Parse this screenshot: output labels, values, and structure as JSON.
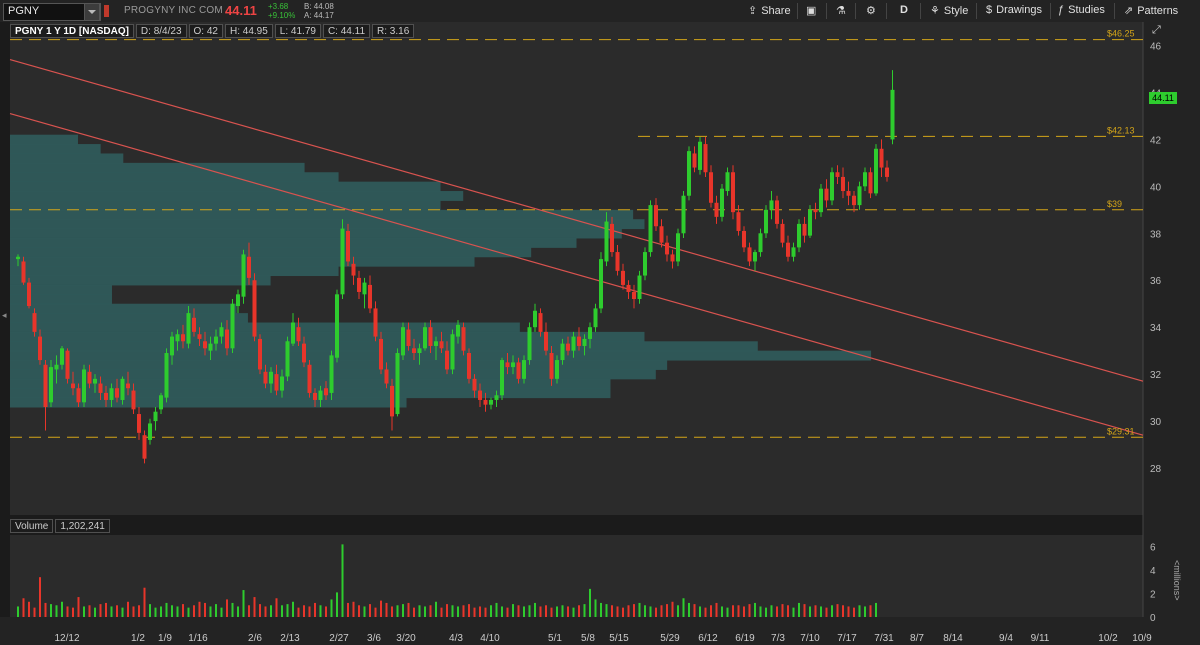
{
  "toolbar": {
    "symbol": "PGNY",
    "company": "PROGYNY INC COM",
    "last": "44.11",
    "change": "+3.68",
    "change_pct": "+9.10%",
    "bid": "B: 44.08",
    "ask": "A: 44.17",
    "share_label": "Share",
    "period_label": "D",
    "style_label": "Style",
    "drawings_label": "Drawings",
    "studies_label": "Studies",
    "patterns_label": "Patterns"
  },
  "info": {
    "symbol_desc": "PGNY 1 Y 1D [NASDAQ]",
    "date": "D: 8/4/23",
    "open": "O: 42",
    "high": "H: 44.95",
    "low": "L: 41.79",
    "close": "C: 44.11",
    "range": "R: 3.16"
  },
  "volume_info": {
    "label": "Volume",
    "value": "1,202,241"
  },
  "price_tag": "44.11",
  "volume_units": "<millions>",
  "colors": {
    "up": "#2ecc2e",
    "down": "#e8352a",
    "profile": "#2f5a5a",
    "level": "#d4a518",
    "trend": "#d9534f",
    "bg": "#2b2b2b"
  },
  "chart_data": {
    "type": "candlestick",
    "ylim": [
      26,
      47
    ],
    "y_ticks": [
      28,
      30,
      32,
      34,
      36,
      38,
      40,
      42,
      44,
      46
    ],
    "x_tick_labels": [
      "12/12",
      "1/2",
      "1/9",
      "1/16",
      "2/6",
      "2/13",
      "2/27",
      "3/6",
      "3/20",
      "4/3",
      "4/10",
      "5/1",
      "5/8",
      "5/15",
      "5/29",
      "6/12",
      "6/19",
      "7/3",
      "7/10",
      "7/17",
      "7/31",
      "8/7",
      "8/14",
      "9/4",
      "9/11",
      "10/2",
      "10/9"
    ],
    "levels": [
      {
        "label": "$46.25",
        "value": 46.25
      },
      {
        "label": "$42.13",
        "value": 42.13
      },
      {
        "label": "$39",
        "value": 39
      },
      {
        "label": "$29.31",
        "value": 29.31
      }
    ],
    "trendlines": [
      {
        "from": [
          0,
          45.4
        ],
        "to": [
          1,
          31.7
        ]
      },
      {
        "from": [
          0,
          43.1
        ],
        "to": [
          1,
          29.4
        ]
      }
    ],
    "volume_profile": [
      {
        "price": 42.0,
        "width": 0.06
      },
      {
        "price": 41.6,
        "width": 0.08
      },
      {
        "price": 41.2,
        "width": 0.1
      },
      {
        "price": 40.8,
        "width": 0.26
      },
      {
        "price": 40.4,
        "width": 0.29
      },
      {
        "price": 40.0,
        "width": 0.38
      },
      {
        "price": 39.6,
        "width": 0.4
      },
      {
        "price": 39.2,
        "width": 0.38
      },
      {
        "price": 38.8,
        "width": 0.55
      },
      {
        "price": 38.4,
        "width": 0.56
      },
      {
        "price": 38.0,
        "width": 0.54
      },
      {
        "price": 37.6,
        "width": 0.5
      },
      {
        "price": 37.2,
        "width": 0.46
      },
      {
        "price": 36.8,
        "width": 0.41
      },
      {
        "price": 36.4,
        "width": 0.29
      },
      {
        "price": 36.0,
        "width": 0.23
      },
      {
        "price": 35.6,
        "width": 0.09
      },
      {
        "price": 35.2,
        "width": 0.09
      },
      {
        "price": 34.8,
        "width": 0.2
      },
      {
        "price": 34.4,
        "width": 0.21
      },
      {
        "price": 34.0,
        "width": 0.45
      },
      {
        "price": 33.6,
        "width": 0.56
      },
      {
        "price": 33.2,
        "width": 0.66
      },
      {
        "price": 32.8,
        "width": 0.76
      },
      {
        "price": 32.4,
        "width": 0.58
      },
      {
        "price": 32.0,
        "width": 0.57
      },
      {
        "price": 31.6,
        "width": 0.53
      },
      {
        "price": 31.2,
        "width": 0.53
      },
      {
        "price": 30.8,
        "width": 0.35
      }
    ],
    "candles": [
      [
        36.9,
        37.1,
        36.6,
        37.0
      ],
      [
        36.8,
        37.0,
        35.8,
        35.9
      ],
      [
        35.9,
        36.1,
        34.8,
        34.9
      ],
      [
        34.6,
        34.8,
        33.6,
        33.8
      ],
      [
        33.6,
        33.9,
        32.4,
        32.6
      ],
      [
        32.4,
        32.6,
        29.6,
        30.6
      ],
      [
        30.8,
        32.6,
        30.6,
        32.3
      ],
      [
        32.2,
        32.8,
        31.6,
        32.4
      ],
      [
        32.4,
        33.2,
        32.2,
        33.1
      ],
      [
        33.0,
        33.1,
        31.6,
        31.8
      ],
      [
        31.6,
        32.1,
        31.1,
        31.4
      ],
      [
        31.4,
        31.6,
        30.6,
        30.8
      ],
      [
        30.8,
        32.4,
        30.6,
        32.2
      ],
      [
        32.1,
        32.4,
        31.4,
        31.6
      ],
      [
        31.6,
        32.0,
        31.2,
        31.8
      ],
      [
        31.6,
        31.9,
        30.9,
        31.2
      ],
      [
        31.2,
        31.5,
        30.6,
        30.9
      ],
      [
        30.9,
        31.6,
        30.6,
        31.4
      ],
      [
        31.4,
        31.8,
        30.8,
        31.0
      ],
      [
        30.9,
        31.9,
        30.7,
        31.8
      ],
      [
        31.6,
        32.1,
        31.1,
        31.4
      ],
      [
        31.3,
        31.6,
        30.3,
        30.5
      ],
      [
        30.3,
        30.6,
        29.2,
        29.5
      ],
      [
        29.4,
        29.6,
        28.2,
        28.4
      ],
      [
        29.2,
        30.1,
        29.0,
        29.9
      ],
      [
        30.0,
        30.6,
        29.6,
        30.4
      ],
      [
        30.5,
        31.2,
        30.3,
        31.1
      ],
      [
        31.0,
        33.1,
        30.8,
        32.9
      ],
      [
        32.8,
        33.8,
        32.4,
        33.6
      ],
      [
        33.4,
        33.9,
        33.0,
        33.7
      ],
      [
        33.7,
        34.1,
        33.1,
        33.4
      ],
      [
        33.3,
        34.9,
        33.1,
        34.6
      ],
      [
        34.4,
        34.8,
        33.6,
        33.8
      ],
      [
        33.7,
        34.0,
        33.2,
        33.5
      ],
      [
        33.4,
        33.8,
        32.8,
        33.1
      ],
      [
        33.0,
        33.6,
        32.6,
        33.3
      ],
      [
        33.3,
        33.9,
        33.0,
        33.6
      ],
      [
        33.6,
        34.2,
        33.3,
        34.0
      ],
      [
        33.9,
        34.3,
        32.8,
        33.1
      ],
      [
        33.1,
        35.2,
        32.9,
        35.0
      ],
      [
        34.9,
        35.6,
        34.6,
        35.4
      ],
      [
        35.3,
        37.3,
        35.0,
        37.1
      ],
      [
        37.0,
        37.6,
        35.8,
        36.1
      ],
      [
        36.0,
        36.3,
        33.4,
        33.6
      ],
      [
        33.5,
        33.7,
        32.0,
        32.2
      ],
      [
        32.1,
        32.4,
        31.4,
        31.6
      ],
      [
        31.6,
        32.3,
        31.2,
        32.1
      ],
      [
        32.0,
        32.4,
        31.1,
        31.3
      ],
      [
        31.3,
        32.2,
        31.0,
        31.9
      ],
      [
        31.9,
        33.6,
        31.7,
        33.4
      ],
      [
        33.3,
        34.6,
        33.2,
        34.2
      ],
      [
        34.0,
        34.4,
        33.2,
        33.4
      ],
      [
        33.3,
        33.6,
        32.3,
        32.5
      ],
      [
        32.4,
        32.6,
        31.0,
        31.2
      ],
      [
        31.2,
        31.4,
        30.6,
        30.9
      ],
      [
        30.9,
        31.5,
        30.6,
        31.3
      ],
      [
        31.4,
        31.7,
        30.9,
        31.1
      ],
      [
        31.2,
        33.0,
        30.9,
        32.8
      ],
      [
        32.7,
        35.6,
        32.5,
        35.4
      ],
      [
        35.4,
        38.6,
        35.2,
        38.2
      ],
      [
        38.1,
        38.4,
        36.6,
        36.8
      ],
      [
        36.7,
        37.0,
        35.8,
        36.2
      ],
      [
        36.1,
        36.4,
        35.2,
        35.5
      ],
      [
        35.4,
        36.1,
        34.8,
        35.9
      ],
      [
        35.8,
        36.2,
        34.6,
        34.8
      ],
      [
        34.8,
        35.1,
        33.4,
        33.6
      ],
      [
        33.5,
        33.8,
        32.0,
        32.2
      ],
      [
        32.2,
        32.5,
        31.4,
        31.6
      ],
      [
        31.5,
        31.8,
        29.6,
        30.2
      ],
      [
        30.3,
        33.1,
        30.2,
        32.9
      ],
      [
        32.8,
        34.2,
        32.6,
        34.0
      ],
      [
        33.9,
        34.2,
        33.0,
        33.2
      ],
      [
        33.1,
        33.5,
        32.6,
        32.9
      ],
      [
        32.9,
        33.3,
        32.4,
        33.1
      ],
      [
        33.1,
        34.2,
        33.0,
        34.0
      ],
      [
        34.0,
        34.3,
        32.9,
        33.2
      ],
      [
        33.2,
        33.6,
        32.6,
        33.4
      ],
      [
        33.4,
        33.8,
        32.9,
        33.1
      ],
      [
        33.0,
        33.4,
        32.0,
        32.2
      ],
      [
        32.2,
        33.9,
        32.0,
        33.7
      ],
      [
        33.6,
        34.3,
        33.3,
        34.1
      ],
      [
        34.0,
        34.2,
        32.8,
        33.0
      ],
      [
        32.9,
        33.1,
        31.6,
        31.8
      ],
      [
        31.8,
        32.0,
        31.0,
        31.3
      ],
      [
        31.3,
        31.6,
        30.6,
        30.9
      ],
      [
        30.9,
        31.2,
        30.4,
        30.7
      ],
      [
        30.7,
        31.0,
        30.5,
        30.9
      ],
      [
        30.9,
        31.3,
        30.6,
        31.1
      ],
      [
        31.1,
        32.7,
        30.9,
        32.6
      ],
      [
        32.5,
        32.9,
        32.0,
        32.3
      ],
      [
        32.3,
        32.8,
        32.0,
        32.5
      ],
      [
        32.5,
        32.7,
        31.6,
        31.8
      ],
      [
        31.8,
        32.8,
        31.6,
        32.6
      ],
      [
        32.6,
        34.2,
        32.4,
        34.0
      ],
      [
        34.0,
        35.0,
        33.8,
        34.7
      ],
      [
        34.6,
        34.8,
        33.6,
        33.8
      ],
      [
        33.8,
        34.2,
        32.8,
        33.0
      ],
      [
        32.9,
        33.2,
        31.5,
        31.8
      ],
      [
        31.8,
        32.8,
        31.6,
        32.6
      ],
      [
        32.6,
        33.5,
        32.4,
        33.3
      ],
      [
        33.3,
        33.6,
        32.8,
        33.0
      ],
      [
        33.0,
        33.8,
        32.7,
        33.6
      ],
      [
        33.6,
        34.0,
        33.0,
        33.2
      ],
      [
        33.2,
        33.7,
        32.8,
        33.5
      ],
      [
        33.5,
        34.2,
        33.1,
        34.0
      ],
      [
        34.0,
        35.0,
        33.8,
        34.8
      ],
      [
        34.8,
        37.2,
        34.6,
        36.9
      ],
      [
        36.8,
        38.9,
        36.6,
        38.5
      ],
      [
        38.4,
        38.7,
        37.0,
        37.2
      ],
      [
        37.2,
        37.5,
        36.2,
        36.4
      ],
      [
        36.4,
        36.7,
        35.6,
        35.8
      ],
      [
        35.8,
        36.0,
        35.2,
        35.5
      ],
      [
        35.5,
        35.8,
        34.8,
        35.2
      ],
      [
        35.2,
        36.4,
        35.0,
        36.2
      ],
      [
        36.2,
        37.4,
        36.0,
        37.2
      ],
      [
        37.2,
        39.4,
        37.0,
        39.2
      ],
      [
        39.2,
        39.5,
        38.1,
        38.3
      ],
      [
        38.3,
        38.6,
        37.4,
        37.6
      ],
      [
        37.6,
        37.9,
        36.8,
        37.1
      ],
      [
        37.1,
        37.3,
        36.5,
        36.8
      ],
      [
        36.8,
        38.2,
        36.6,
        38.0
      ],
      [
        38.0,
        39.8,
        37.8,
        39.6
      ],
      [
        39.6,
        41.7,
        39.4,
        41.5
      ],
      [
        41.4,
        41.7,
        40.6,
        40.8
      ],
      [
        40.7,
        42.1,
        40.5,
        41.9
      ],
      [
        41.8,
        42.1,
        40.4,
        40.6
      ],
      [
        40.6,
        40.9,
        39.1,
        39.3
      ],
      [
        39.3,
        39.6,
        38.4,
        38.7
      ],
      [
        38.7,
        40.1,
        38.5,
        39.9
      ],
      [
        39.8,
        40.8,
        39.6,
        40.6
      ],
      [
        40.6,
        40.9,
        38.6,
        38.9
      ],
      [
        38.9,
        39.2,
        37.9,
        38.1
      ],
      [
        38.1,
        38.3,
        37.2,
        37.4
      ],
      [
        37.4,
        37.6,
        36.6,
        36.8
      ],
      [
        36.8,
        37.3,
        36.4,
        37.2
      ],
      [
        37.2,
        38.2,
        37.0,
        38.0
      ],
      [
        38.0,
        39.2,
        37.8,
        39.0
      ],
      [
        39.0,
        39.8,
        38.6,
        39.4
      ],
      [
        39.4,
        39.6,
        38.2,
        38.4
      ],
      [
        38.4,
        38.6,
        37.4,
        37.6
      ],
      [
        37.6,
        37.9,
        36.8,
        37.0
      ],
      [
        37.0,
        37.6,
        36.8,
        37.4
      ],
      [
        37.4,
        38.6,
        37.2,
        38.4
      ],
      [
        38.4,
        38.7,
        37.6,
        37.9
      ],
      [
        37.9,
        39.2,
        37.8,
        39.0
      ],
      [
        39.0,
        39.3,
        38.6,
        38.9
      ],
      [
        38.9,
        40.1,
        38.7,
        39.9
      ],
      [
        39.9,
        40.3,
        39.1,
        39.4
      ],
      [
        39.4,
        40.8,
        39.2,
        40.6
      ],
      [
        40.6,
        40.9,
        40.1,
        40.4
      ],
      [
        40.4,
        40.8,
        39.5,
        39.8
      ],
      [
        39.8,
        40.2,
        39.2,
        39.6
      ],
      [
        39.6,
        39.8,
        38.9,
        39.2
      ],
      [
        39.2,
        40.2,
        39.0,
        40.0
      ],
      [
        40.0,
        40.8,
        39.8,
        40.6
      ],
      [
        40.6,
        40.8,
        39.5,
        39.7
      ],
      [
        39.7,
        41.8,
        39.6,
        41.6
      ],
      [
        41.6,
        42.0,
        40.4,
        40.8
      ],
      [
        40.8,
        41.1,
        40.2,
        40.4
      ],
      [
        42.0,
        44.95,
        41.79,
        44.11
      ]
    ],
    "volume": {
      "ylim": [
        0,
        7
      ],
      "y_ticks": [
        0,
        2,
        4,
        6
      ],
      "values": [
        0.9,
        1.6,
        1.3,
        0.8,
        3.4,
        1.2,
        1.1,
        1.0,
        1.3,
        0.9,
        0.8,
        1.7,
        0.9,
        1.0,
        0.8,
        1.1,
        1.2,
        0.9,
        1.0,
        0.8,
        1.3,
        0.9,
        1.0,
        2.5,
        1.1,
        0.8,
        0.9,
        1.2,
        1.0,
        0.9,
        1.1,
        0.8,
        1.0,
        1.3,
        1.2,
        0.9,
        1.1,
        0.8,
        1.5,
        1.2,
        0.9,
        2.3,
        1.0,
        1.7,
        1.1,
        0.9,
        1.0,
        1.6,
        1.0,
        1.1,
        1.3,
        0.8,
        1.0,
        0.9,
        1.2,
        1.0,
        0.9,
        1.5,
        2.1,
        6.2,
        1.2,
        1.3,
        1.0,
        0.9,
        1.1,
        0.8,
        1.4,
        1.2,
        0.9,
        1.0,
        1.1,
        1.2,
        0.8,
        1.0,
        0.9,
        1.0,
        1.3,
        0.8,
        1.1,
        1.0,
        0.9,
        1.0,
        1.1,
        0.8,
        0.9,
        0.8,
        1.0,
        1.2,
        0.9,
        0.8,
        1.1,
        1.0,
        0.9,
        1.0,
        1.2,
        0.9,
        1.0,
        0.8,
        0.9,
        1.0,
        0.9,
        0.8,
        1.0,
        1.1,
        2.4,
        1.5,
        1.2,
        1.1,
        1.0,
        0.9,
        0.8,
        1.0,
        1.1,
        1.2,
        1.0,
        0.9,
        0.8,
        1.0,
        1.1,
        1.3,
        1.0,
        1.6,
        1.2,
        1.1,
        0.9,
        0.8,
        1.0,
        1.2,
        0.9,
        0.8,
        1.0,
        1.0,
        0.9,
        1.1,
        1.2,
        0.9,
        0.8,
        1.0,
        0.9,
        1.1,
        1.0,
        0.8,
        1.2,
        1.1,
        0.9,
        1.0,
        0.9,
        0.8,
        1.0,
        1.1,
        1.0,
        0.9,
        0.8,
        1.0,
        0.9,
        1.0,
        1.2
      ]
    }
  }
}
